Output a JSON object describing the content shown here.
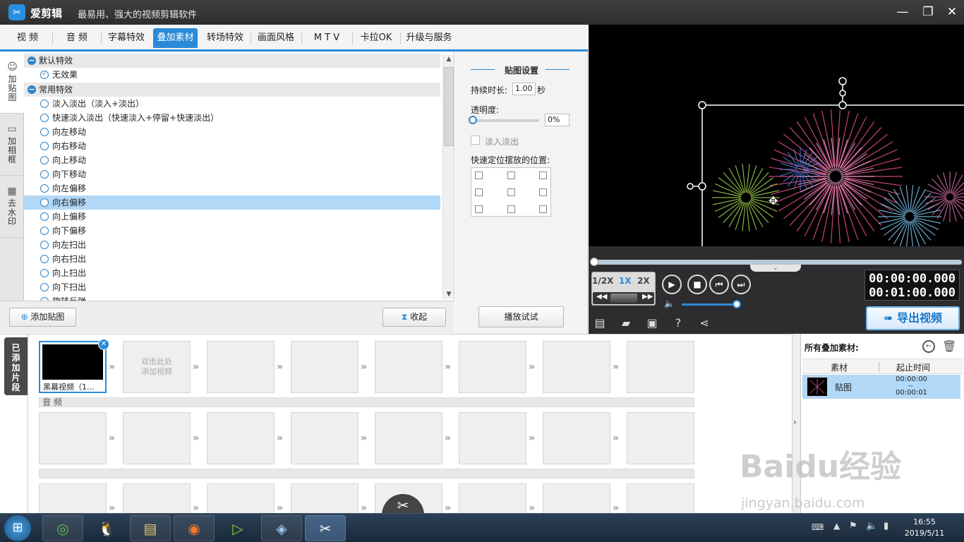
{
  "app": {
    "name": "爱剪辑",
    "slogan": "最易用、强大的视频剪辑软件"
  },
  "tabs": [
    "视 频",
    "音 频",
    "字幕特效",
    "叠加素材",
    "转场特效",
    "画面风格",
    "M T V",
    "卡拉OK",
    "升级与服务"
  ],
  "side_tabs": [
    {
      "label": "加贴图",
      "icon": "sticker-icon"
    },
    {
      "label": "加相框",
      "icon": "frame-icon"
    },
    {
      "label": "去水印",
      "icon": "watermark-icon"
    }
  ],
  "effects": {
    "group1": "默认特效",
    "none": "无效果",
    "group2": "常用特效",
    "items": [
      "淡入淡出（淡入+淡出）",
      "快速淡入淡出（快速淡入+停留+快速淡出）",
      "向左移动",
      "向右移动",
      "向上移动",
      "向下移动",
      "向左偏移",
      "向右偏移",
      "向上偏移",
      "向下偏移",
      "向左扫出",
      "向右扫出",
      "向上扫出",
      "向下扫出"
    ],
    "partial_item": "旋转反弹",
    "selected_index": 7
  },
  "buttons": {
    "add_sticker": "添加贴图",
    "collapse": "收起",
    "preview_play": "播放试试",
    "export": "导出视频"
  },
  "settings": {
    "title": "贴图设置",
    "duration_label": "持续时长:",
    "duration_value": "1.00",
    "duration_unit": "秒",
    "opacity_label": "透明度:",
    "opacity_value": "0%",
    "fade_label": "淡入淡出",
    "position_label": "快速定位摆放的位置:"
  },
  "player": {
    "speeds": [
      "1/2X",
      "1X",
      "2X"
    ],
    "active_speed": "1X",
    "time_current": "00:00:00.000",
    "time_total": "00:01:00.000"
  },
  "timeline": {
    "side_label": "已添加片段",
    "first_clip": "黑幕视频（1...",
    "empty_hint": "双击此处\n添加视频",
    "audio_label": "音 频"
  },
  "right_panel": {
    "title": "所有叠加素材:",
    "col_material": "素材",
    "col_time": "起止时间",
    "row_name": "贴图",
    "row_start": "00:00:00",
    "row_dash": "--",
    "row_end": "00:00:01"
  },
  "taskbar": {
    "time": "16:55",
    "date": "2019/5/11"
  },
  "watermark": {
    "main": "Baidu经验",
    "sub": "jingyan.baidu.com"
  },
  "colors": {
    "accent": "#2b8ad8",
    "selected_row": "#b2d8f7",
    "titlebar": "#3a3a3c"
  }
}
